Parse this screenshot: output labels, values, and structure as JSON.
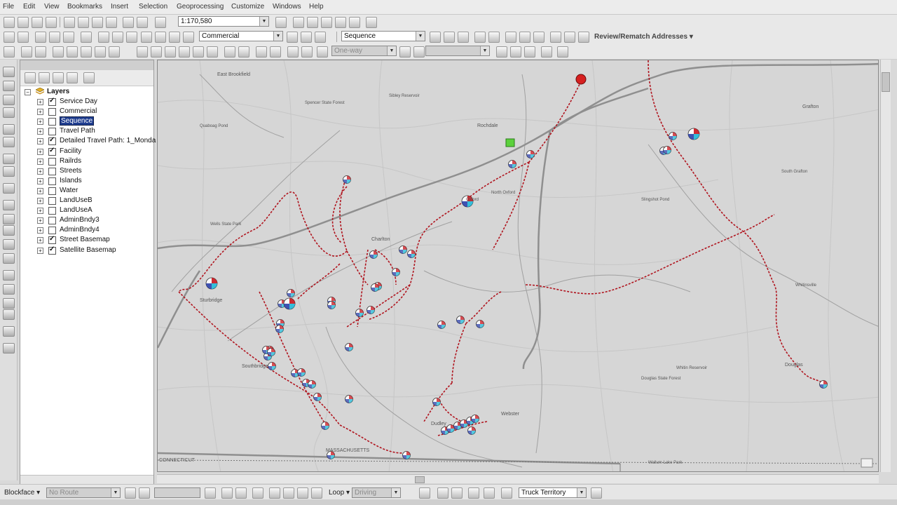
{
  "menu": [
    "File",
    "Edit",
    "View",
    "Bookmarks",
    "Insert",
    "Selection",
    "Geoprocessing",
    "Customize",
    "Windows",
    "Help"
  ],
  "toolbar1": {
    "scale_value": "1:170,580"
  },
  "toolbar2": {
    "layer_combo": "Commercial",
    "field_combo": "Sequence",
    "review_label": "Review/Rematch Addresses"
  },
  "toolbar3": {
    "oneway_combo": "One-way"
  },
  "toc": {
    "root_label": "Layers",
    "layers": [
      {
        "label": "Service Day",
        "checked": true,
        "selected": false
      },
      {
        "label": "Commercial",
        "checked": false,
        "selected": false
      },
      {
        "label": "Sequence",
        "checked": false,
        "selected": true
      },
      {
        "label": "Travel Path",
        "checked": false,
        "selected": false
      },
      {
        "label": "Detailed Travel Path: 1_Monda",
        "checked": true,
        "selected": false
      },
      {
        "label": "Facility",
        "checked": true,
        "selected": false
      },
      {
        "label": "Railrds",
        "checked": false,
        "selected": false
      },
      {
        "label": "Streets",
        "checked": false,
        "selected": false
      },
      {
        "label": "Islands",
        "checked": false,
        "selected": false
      },
      {
        "label": "Water",
        "checked": false,
        "selected": false
      },
      {
        "label": "LandUseB",
        "checked": false,
        "selected": false
      },
      {
        "label": "LandUseA",
        "checked": false,
        "selected": false
      },
      {
        "label": "AdminBndy3",
        "checked": false,
        "selected": false
      },
      {
        "label": "AdminBndy4",
        "checked": false,
        "selected": false
      },
      {
        "label": "Street Basemap",
        "checked": true,
        "selected": false
      },
      {
        "label": "Satellite Basemap",
        "checked": true,
        "selected": false
      }
    ]
  },
  "map": {
    "place_labels": [
      "East Brookfield",
      "Spencer State Forest",
      "Sibley Reservoir",
      "Rochdale",
      "Quaboag Pond",
      "Charlton",
      "Wells State Park",
      "Sturbridge",
      "North Oxford",
      "Southbridge",
      "Dudley",
      "Webster",
      "Douglas",
      "Grafton",
      "South Grafton",
      "Whitinsville",
      "Wallum Lake Park",
      "MASSACHUSETTS",
      "CONNECTICUT",
      "Oxford",
      "Douglas State Forest",
      "Whitin Reservoir",
      "Slingshot Pond"
    ],
    "colors": {
      "route": "#b0141e",
      "background": "#d6d6d6",
      "roads": "#8f8f8f"
    }
  },
  "bottombar": {
    "blockface_label": "Blockface",
    "no_route_combo": "No Route",
    "loop_label": "Loop",
    "driving_combo": "Driving",
    "territory_combo": "Truck Territory"
  }
}
